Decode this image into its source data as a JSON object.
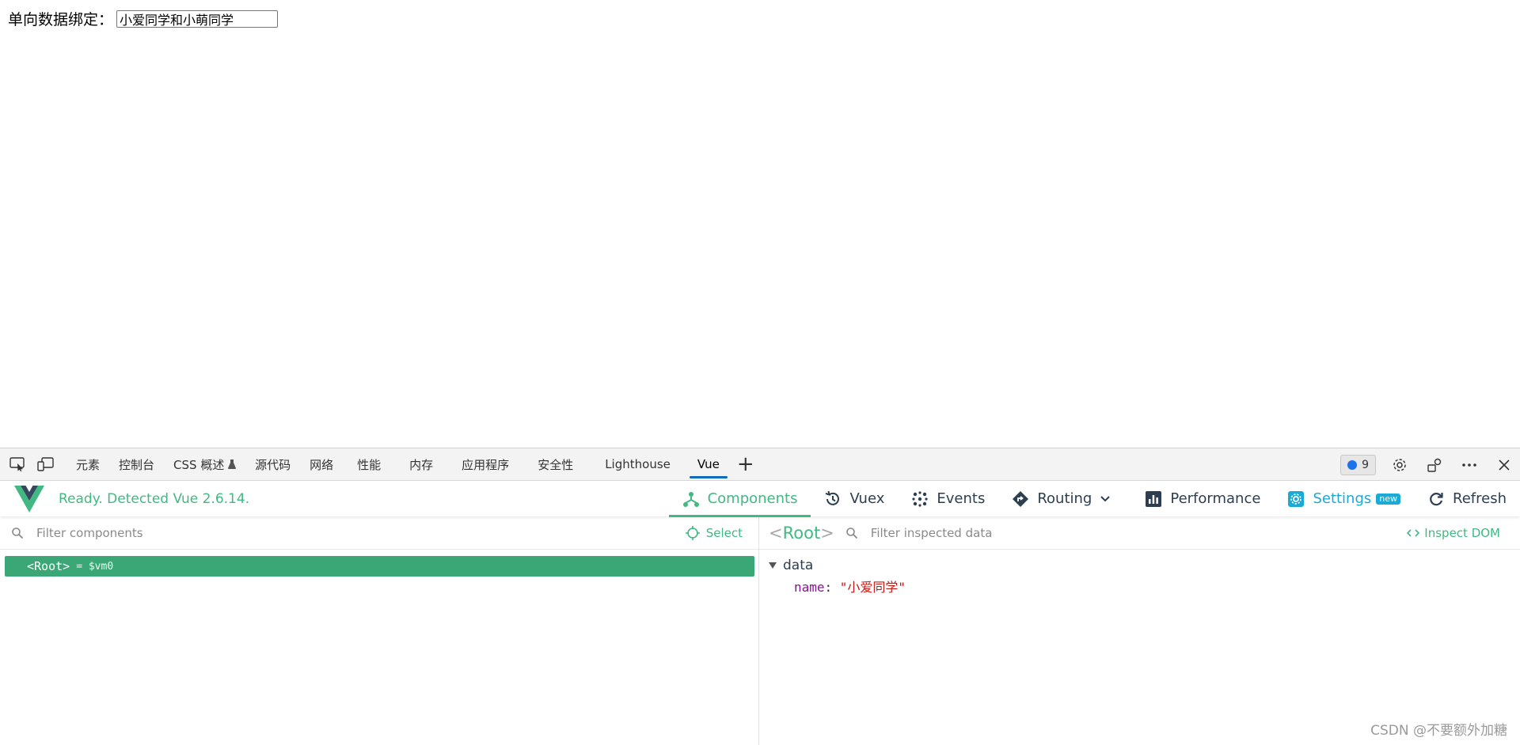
{
  "page": {
    "binding_label": "单向数据绑定：",
    "binding_value": "小爱同学和小萌同学"
  },
  "devtools": {
    "tabs": [
      {
        "label": "元素"
      },
      {
        "label": "控制台"
      },
      {
        "label": "CSS 概述"
      },
      {
        "label": "源代码"
      },
      {
        "label": "网络"
      },
      {
        "label": "性能"
      },
      {
        "label": "内存"
      },
      {
        "label": "应用程序"
      },
      {
        "label": "安全性"
      },
      {
        "label": "Lighthouse"
      },
      {
        "label": "Vue"
      }
    ],
    "active_tab": "Vue",
    "add_tab": "+",
    "issues_count": "9"
  },
  "vue": {
    "status": "Ready. Detected Vue 2.6.14.",
    "nav": {
      "components": "Components",
      "vuex": "Vuex",
      "events": "Events",
      "routing": "Routing",
      "performance": "Performance",
      "settings": "Settings",
      "settings_badge": "new",
      "refresh": "Refresh"
    },
    "colors": {
      "accent": "#42b883",
      "settings": "#1ba9d6",
      "selected_row": "#3ba776"
    }
  },
  "components_pane": {
    "filter_placeholder": "Filter components",
    "select_label": "Select",
    "tree": [
      {
        "tag": "<Root>",
        "suffix": "= $vm0"
      }
    ]
  },
  "inspector": {
    "title_open": "<",
    "title_name": "Root",
    "title_close": ">",
    "filter_placeholder": "Filter inspected data",
    "inspect_dom": "Inspect DOM",
    "section": "data",
    "props": [
      {
        "key": "name",
        "value": "\"小爱同学\""
      }
    ]
  },
  "watermark": "CSDN @不要额外加糖"
}
